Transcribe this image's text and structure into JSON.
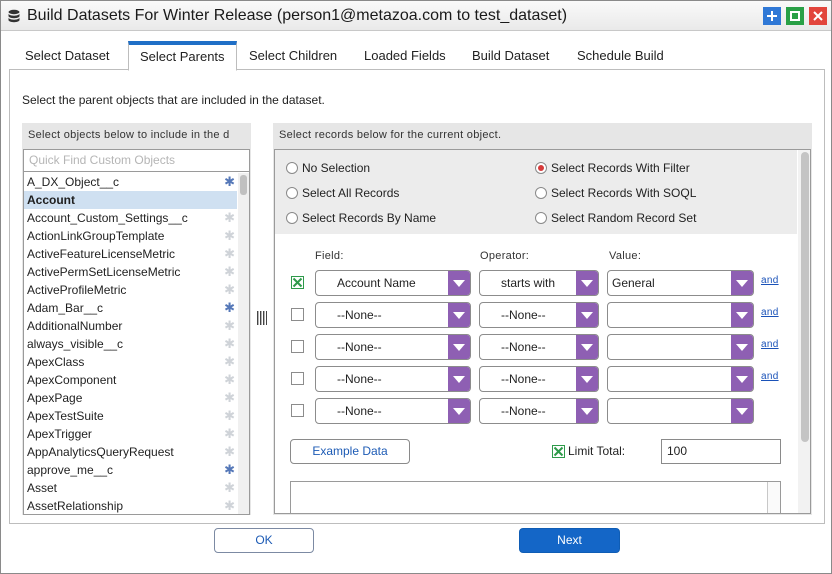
{
  "window": {
    "title": "Build Datasets For Winter Release (person1@metazoa.com to test_dataset)",
    "title_icon": "database-icon",
    "buttons": [
      "maximize-icon",
      "restore-icon",
      "close-icon"
    ]
  },
  "tabs": [
    {
      "label": "Select Dataset",
      "active": false
    },
    {
      "label": "Select Parents",
      "active": true
    },
    {
      "label": "Select Children",
      "active": false
    },
    {
      "label": "Loaded Fields",
      "active": false
    },
    {
      "label": "Build Dataset",
      "active": false
    },
    {
      "label": "Schedule Build",
      "active": false
    }
  ],
  "instruction": "Select the parent objects that are included in the dataset.",
  "left_panel": {
    "header": "Select objects below to include in the d",
    "quick_find_placeholder": "Quick Find Custom Objects",
    "items": [
      {
        "label": "A_DX_Object__c",
        "selected": false,
        "starred": true
      },
      {
        "label": "Account",
        "selected": true,
        "starred": false
      },
      {
        "label": "Account_Custom_Settings__c",
        "selected": false,
        "starred": false
      },
      {
        "label": "ActionLinkGroupTemplate",
        "selected": false,
        "starred": false
      },
      {
        "label": "ActiveFeatureLicenseMetric",
        "selected": false,
        "starred": false
      },
      {
        "label": "ActivePermSetLicenseMetric",
        "selected": false,
        "starred": false
      },
      {
        "label": "ActiveProfileMetric",
        "selected": false,
        "starred": false
      },
      {
        "label": "Adam_Bar__c",
        "selected": false,
        "starred": true
      },
      {
        "label": "AdditionalNumber",
        "selected": false,
        "starred": false
      },
      {
        "label": "always_visible__c",
        "selected": false,
        "starred": false
      },
      {
        "label": "ApexClass",
        "selected": false,
        "starred": false
      },
      {
        "label": "ApexComponent",
        "selected": false,
        "starred": false
      },
      {
        "label": "ApexPage",
        "selected": false,
        "starred": false
      },
      {
        "label": "ApexTestSuite",
        "selected": false,
        "starred": false
      },
      {
        "label": "ApexTrigger",
        "selected": false,
        "starred": false
      },
      {
        "label": "AppAnalyticsQueryRequest",
        "selected": false,
        "starred": false
      },
      {
        "label": "approve_me__c",
        "selected": false,
        "starred": true
      },
      {
        "label": "Asset",
        "selected": false,
        "starred": false
      },
      {
        "label": "AssetRelationship",
        "selected": false,
        "starred": false
      }
    ]
  },
  "right_panel": {
    "header": "Select records below for the current object.",
    "radio_options": [
      {
        "label": "No Selection",
        "checked": false
      },
      {
        "label": "Select Records With Filter",
        "checked": true
      },
      {
        "label": "Select All Records",
        "checked": false
      },
      {
        "label": "Select Records With SOQL",
        "checked": false
      },
      {
        "label": "Select Records By Name",
        "checked": false
      },
      {
        "label": "Select Random Record Set",
        "checked": false
      }
    ],
    "column_headers": {
      "field": "Field:",
      "operator": "Operator:",
      "value": "Value:"
    },
    "filter_rows": [
      {
        "checked": true,
        "field": "Account Name",
        "operator": "starts with",
        "value": "General",
        "link": "and"
      },
      {
        "checked": false,
        "field": "--None--",
        "operator": "--None--",
        "value": "",
        "link": "and"
      },
      {
        "checked": false,
        "field": "--None--",
        "operator": "--None--",
        "value": "",
        "link": "and"
      },
      {
        "checked": false,
        "field": "--None--",
        "operator": "--None--",
        "value": "",
        "link": "and"
      },
      {
        "checked": false,
        "field": "--None--",
        "operator": "--None--",
        "value": "",
        "link": ""
      }
    ],
    "example_button": "Example Data",
    "limit_total": {
      "label": "Limit Total:",
      "checked": true,
      "value": "100"
    }
  },
  "footer": {
    "ok_label": "OK",
    "next_label": "Next"
  },
  "colors": {
    "accent": "#1f6fc7",
    "dropdown_arrow": "#8e5fb3",
    "checkbox_green": "#2e9a4a",
    "radio_on": "#d63a3a",
    "next_button": "#1466c7"
  }
}
